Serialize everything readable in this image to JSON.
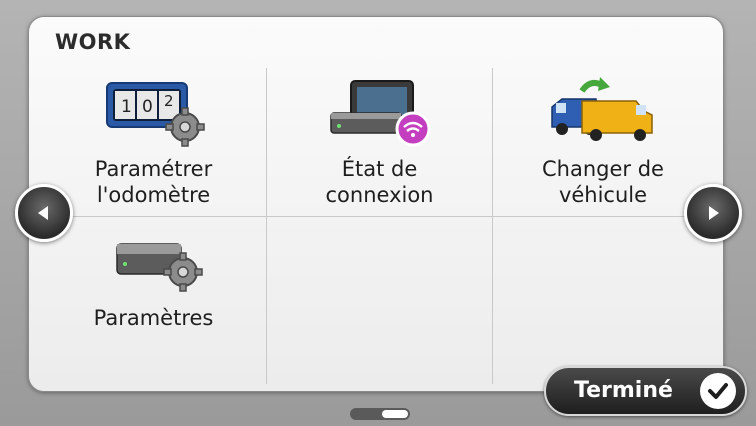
{
  "panel": {
    "title": "WORK"
  },
  "items": [
    {
      "label": "Paramétrer\nl'odomètre",
      "icon": "odometer-gear-icon",
      "odometer_digits": "1 0 2"
    },
    {
      "label": "État de\nconnexion",
      "icon": "device-wifi-icon"
    },
    {
      "label": "Changer de\nvéhicule",
      "icon": "vehicle-swap-icon"
    },
    {
      "label": "Paramètres",
      "icon": "device-gear-icon"
    }
  ],
  "navigation": {
    "prev_icon": "triangle-left-icon",
    "next_icon": "triangle-right-icon"
  },
  "done_button": {
    "label": "Terminé",
    "icon": "checkmark-icon"
  },
  "page_indicator": {
    "current_page": 2,
    "page_count": 2
  },
  "colors": {
    "wifi_badge": "#c33fc0",
    "van_blue": "#2f5fb3",
    "van_yellow": "#f0b116",
    "arrow_green": "#46a83c",
    "odometer_blue": "#2a5aa6"
  }
}
